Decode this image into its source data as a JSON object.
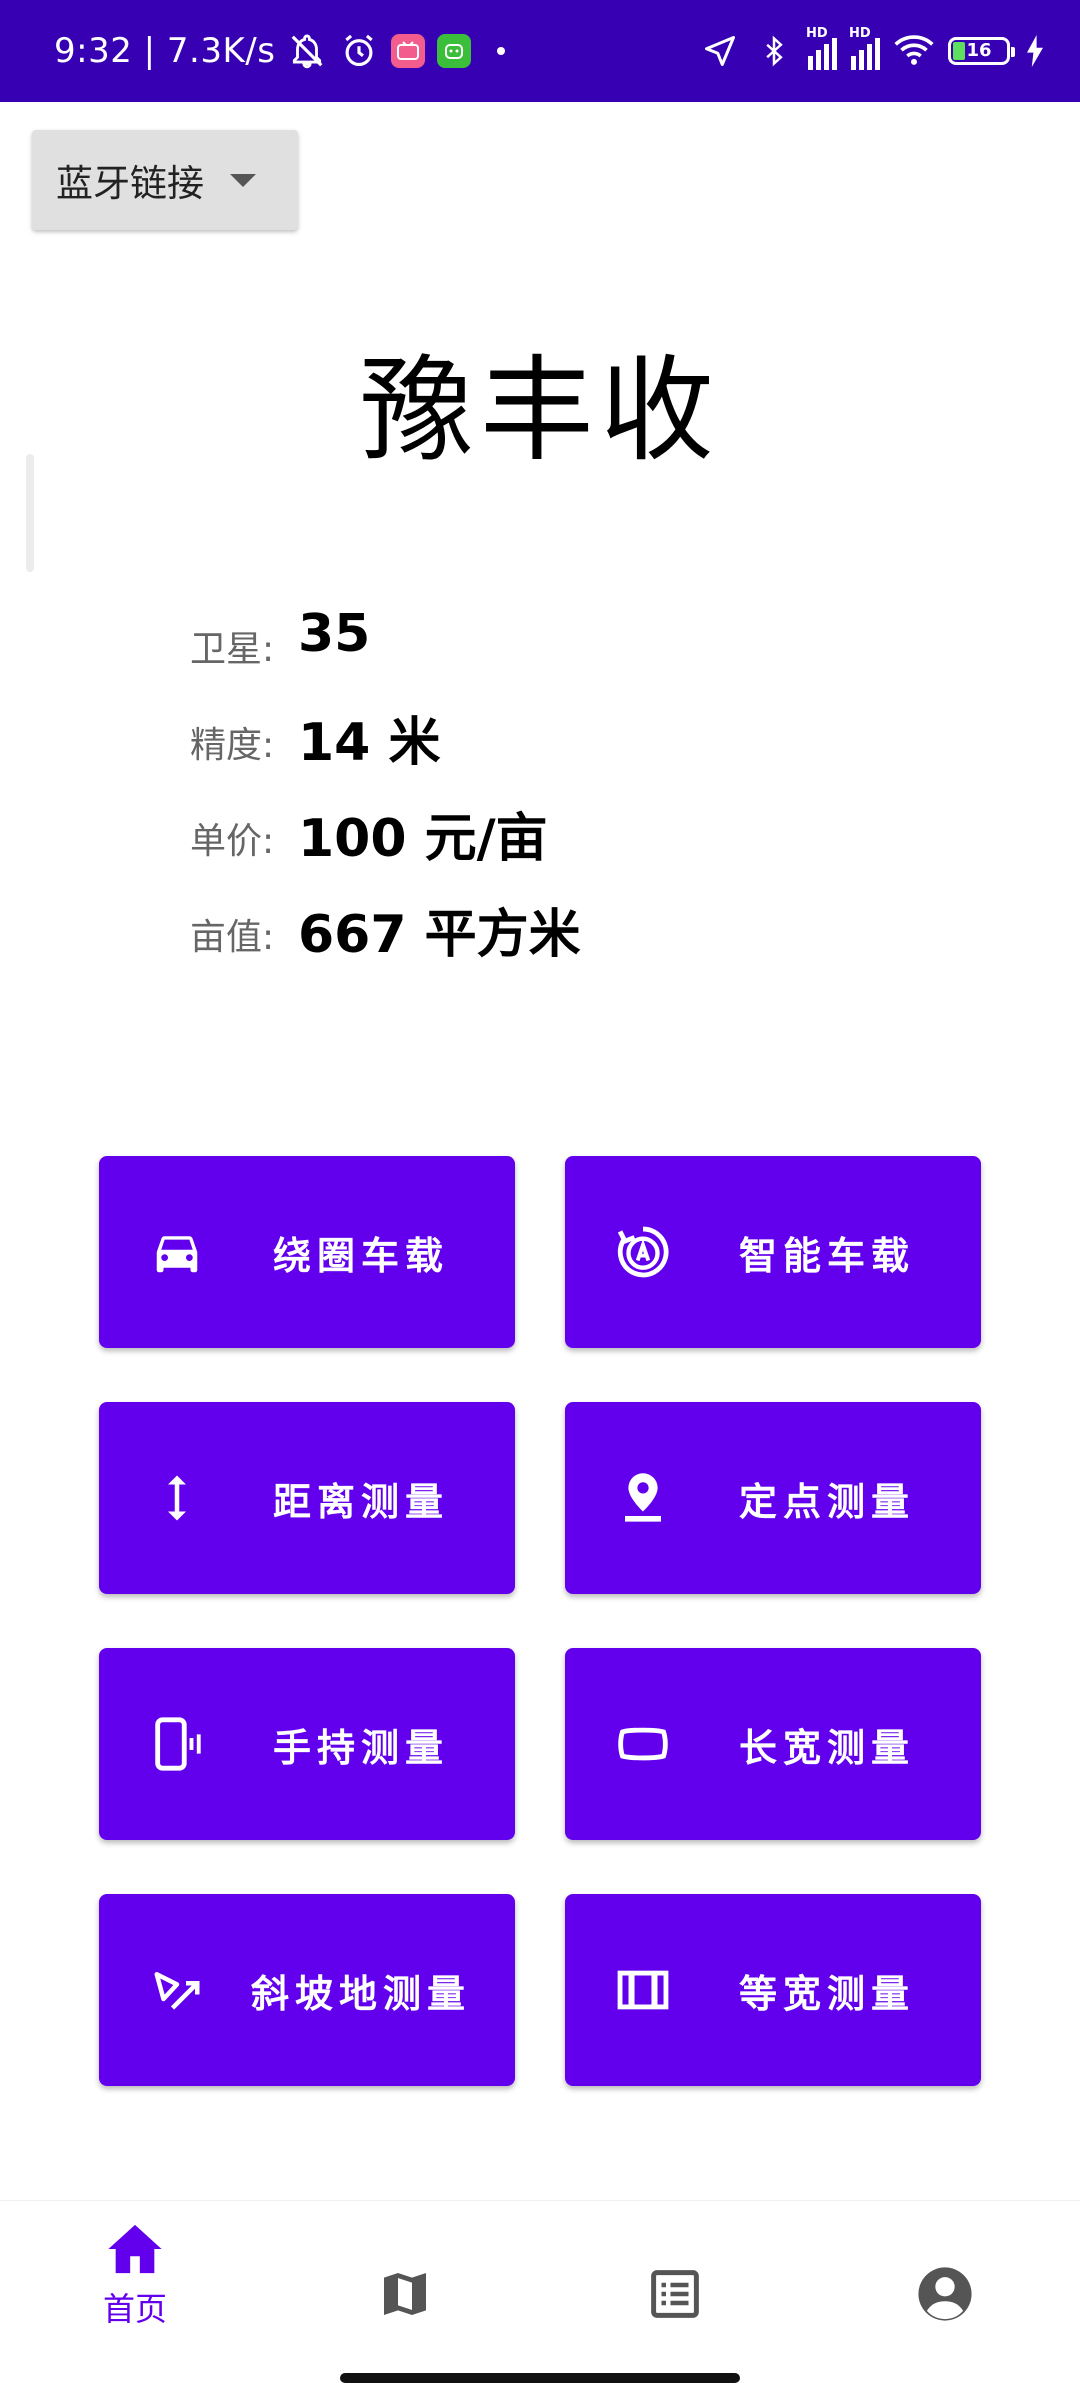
{
  "status_bar": {
    "time_speed": "9:32 | 7.3K/s",
    "hd_label": "HD",
    "battery_level": "16",
    "app_badges": [
      "bilibili",
      "app"
    ]
  },
  "bluetooth": {
    "label": "蓝牙链接"
  },
  "title": "豫丰收",
  "info": [
    {
      "label": "卫星:",
      "value": "35"
    },
    {
      "label": "精度:",
      "value": "14 米"
    },
    {
      "label": "单价:",
      "value": "100 元/亩"
    },
    {
      "label": "亩值:",
      "value": "667 平方米"
    }
  ],
  "buttons": [
    {
      "label": "绕圈车载",
      "icon": "car-icon"
    },
    {
      "label": "智能车载",
      "icon": "auto-mode-icon"
    },
    {
      "label": "距离测量",
      "icon": "vertical-arrows-icon"
    },
    {
      "label": "定点测量",
      "icon": "location-pin-icon"
    },
    {
      "label": "手持测量",
      "icon": "phone-vibrate-icon"
    },
    {
      "label": "长宽测量",
      "icon": "rectangle-icon"
    },
    {
      "label": "斜坡地测量",
      "icon": "slope-icon"
    },
    {
      "label": "等宽测量",
      "icon": "equal-width-icon"
    }
  ],
  "bottom_nav": [
    {
      "label": "首页",
      "icon": "home-icon",
      "active": true
    },
    {
      "label": "",
      "icon": "map-icon",
      "active": false
    },
    {
      "label": "",
      "icon": "list-icon",
      "active": false
    },
    {
      "label": "",
      "icon": "account-icon",
      "active": false
    }
  ],
  "colors": {
    "status_bar": "#3700b3",
    "primary": "#6200ee",
    "inactive_icon": "#555555"
  }
}
